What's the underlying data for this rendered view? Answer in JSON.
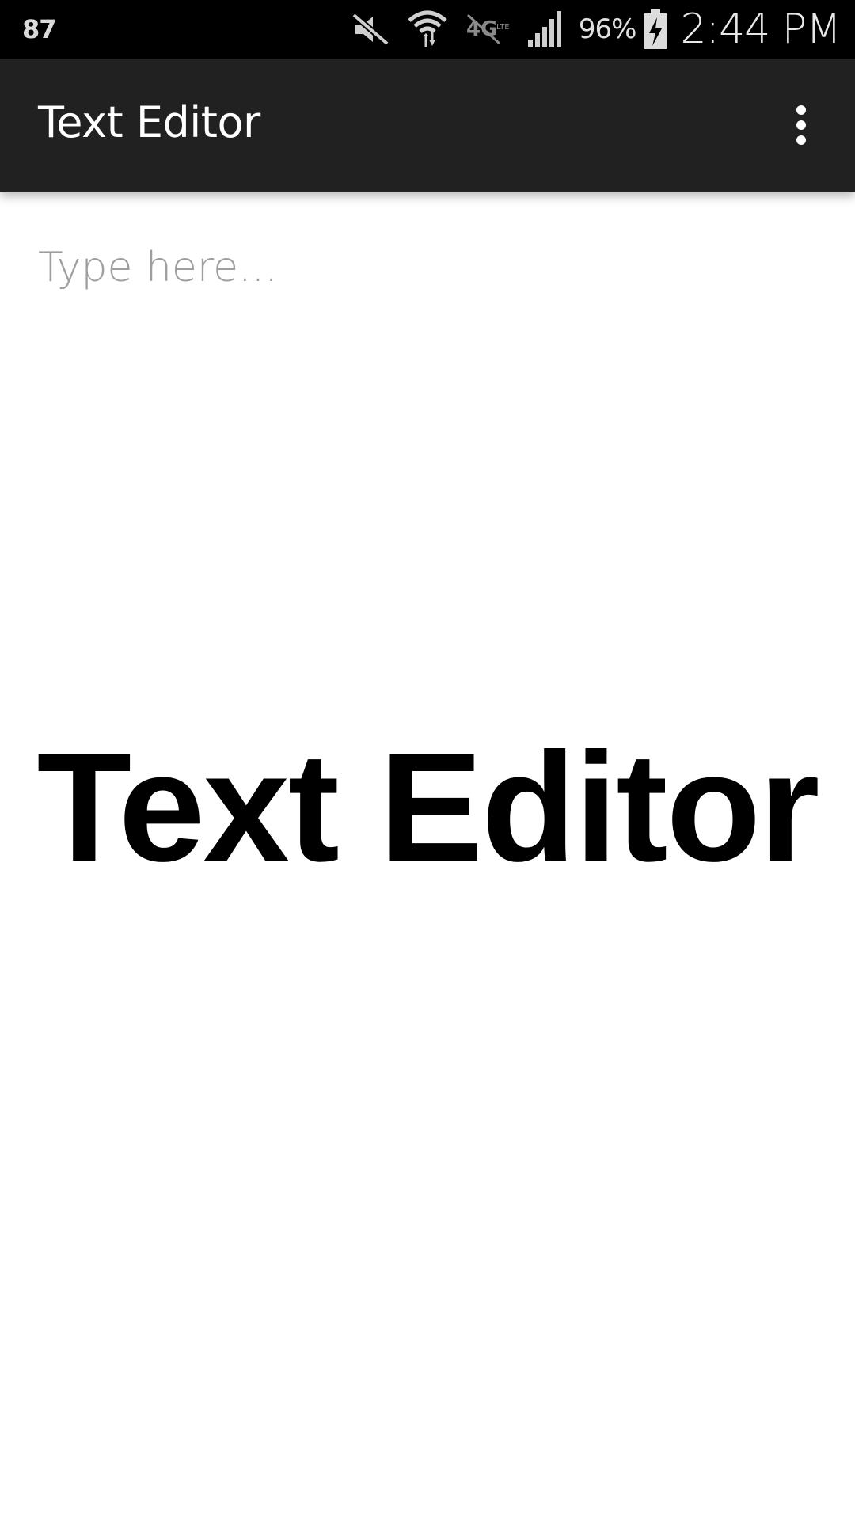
{
  "status_bar": {
    "left_text": "87",
    "battery_percent": "96%",
    "time": "2:44 PM",
    "icons": [
      "mute-icon",
      "wifi-icon",
      "no-4g-lte-icon",
      "signal-icon",
      "battery-charging-icon"
    ]
  },
  "app_bar": {
    "title": "Text Editor",
    "overflow_icon": "more-vert-icon"
  },
  "editor": {
    "placeholder": "Type here...",
    "value": ""
  },
  "splash": {
    "text": "Text Editor"
  }
}
